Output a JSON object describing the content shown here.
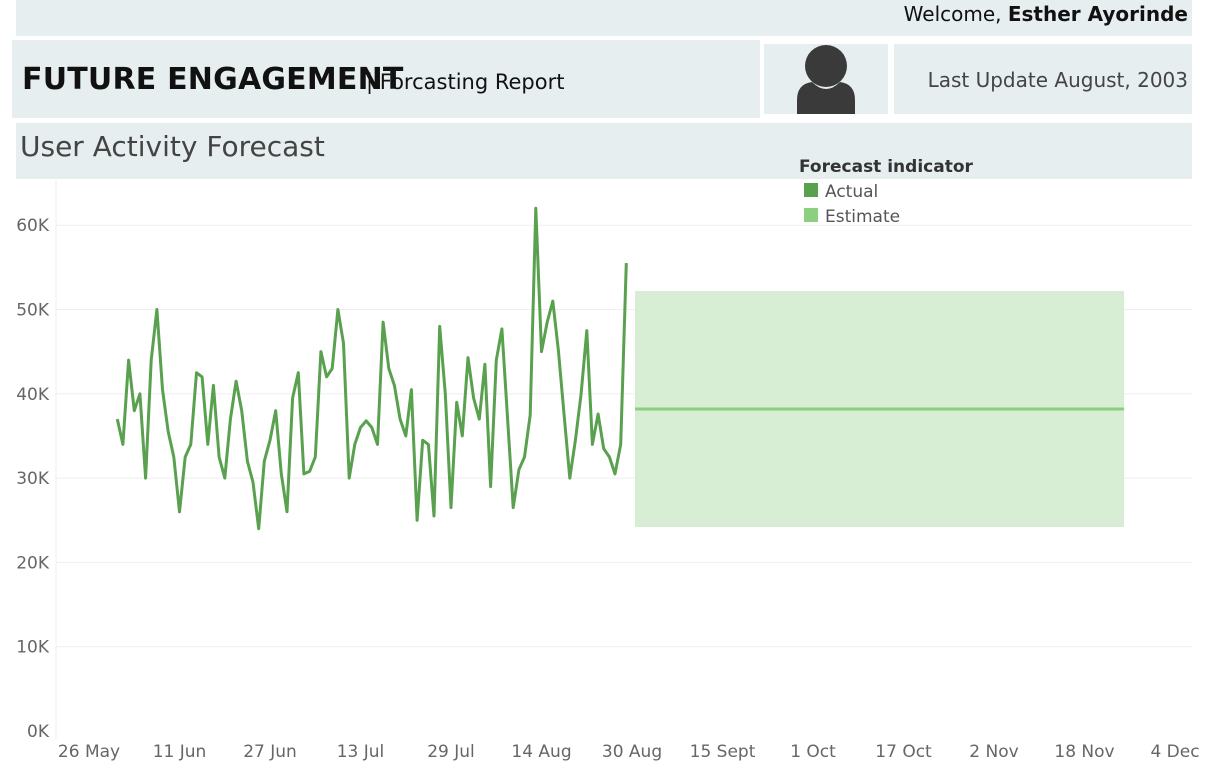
{
  "header": {
    "welcome_prefix": "Welcome, ",
    "user_name": "Esther Ayorinde",
    "title": "FUTURE ENGAGEMENT",
    "subtitle": "| Forcasting Report",
    "avatar_icon": "user-icon",
    "last_update": "Last Update August, 2003"
  },
  "colors": {
    "panel_bg": "#e6eef0",
    "actual": "#59a14f",
    "estimate": "#8ccf7e",
    "band": "#d7edd4"
  },
  "chart_data": {
    "type": "line",
    "title": "User Activity Forecast",
    "xlabel": "",
    "ylabel": "",
    "ylim": [
      0,
      65000
    ],
    "y_ticks": [
      "0K",
      "10K",
      "20K",
      "30K",
      "40K",
      "50K",
      "60K"
    ],
    "y_tick_values": [
      0,
      10000,
      20000,
      30000,
      40000,
      50000,
      60000
    ],
    "x_ticks": [
      "26 May",
      "11 Jun",
      "27 Jun",
      "13 Jul",
      "29 Jul",
      "14 Aug",
      "30 Aug",
      "15 Sept",
      "1 Oct",
      "17 Oct",
      "2 Nov",
      "18 Nov",
      "4 Dec"
    ],
    "grid": true,
    "legend": {
      "title": "Forecast indicator",
      "position": "top-center",
      "entries": [
        "Actual",
        "Estimate"
      ]
    },
    "series": [
      {
        "name": "Actual",
        "start_tick": "26 May",
        "start_day_index": 5,
        "values": [
          37000,
          34000,
          44000,
          38000,
          40000,
          30000,
          44000,
          50000,
          40500,
          35500,
          32500,
          26000,
          32500,
          34000,
          42500,
          42000,
          34000,
          41000,
          32500,
          30000,
          37000,
          41500,
          38000,
          32000,
          29500,
          24000,
          32000,
          34500,
          38000,
          30500,
          26000,
          39500,
          42500,
          30500,
          30800,
          32500,
          45000,
          42000,
          43000,
          50000,
          46000,
          30000,
          34000,
          36000,
          36800,
          36000,
          34000,
          48500,
          43000,
          41000,
          37000,
          35000,
          40500,
          25000,
          34500,
          34000,
          25500,
          48000,
          40000,
          26500,
          39000,
          35000,
          44300,
          39500,
          37000,
          43500,
          29000,
          44000,
          47700,
          37000,
          26500,
          31000,
          32500,
          37500,
          62000,
          45000,
          48500,
          51000,
          45000,
          37500,
          30000,
          34500,
          40000,
          47500,
          34000,
          37600,
          33500,
          32500,
          30500,
          34000,
          55500
        ]
      },
      {
        "name": "Estimate",
        "start_tick": "30 Aug",
        "end_tick": "25 Nov",
        "value": 38200,
        "upper": 52200,
        "lower": 24200
      }
    ]
  }
}
